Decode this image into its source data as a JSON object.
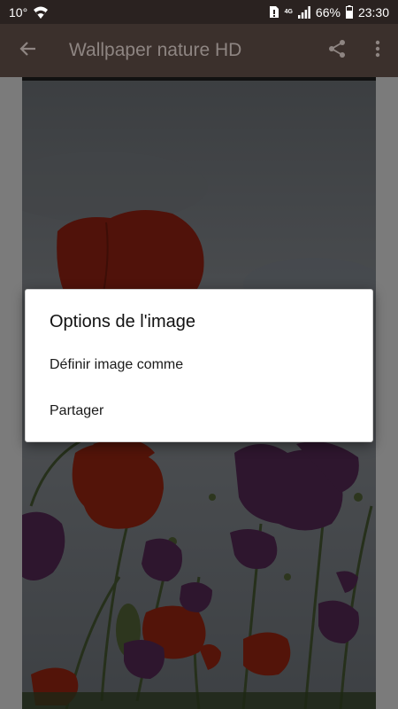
{
  "status_bar": {
    "temperature": "10°",
    "network": "4G",
    "battery": "66%",
    "time": "23:30"
  },
  "app_bar": {
    "title": "Wallpaper nature HD",
    "icons": [
      "back-arrow-icon",
      "share-icon",
      "more-vert-icon"
    ]
  },
  "dialog": {
    "title": "Options de l'image",
    "options": [
      {
        "label": "Définir image comme"
      },
      {
        "label": "Partager"
      }
    ]
  },
  "colors": {
    "status_bar_bg": "#2a2220",
    "app_bar_bg": "#3b302c",
    "app_bar_title": "#8e8582",
    "dialog_bg": "#ffffff"
  }
}
